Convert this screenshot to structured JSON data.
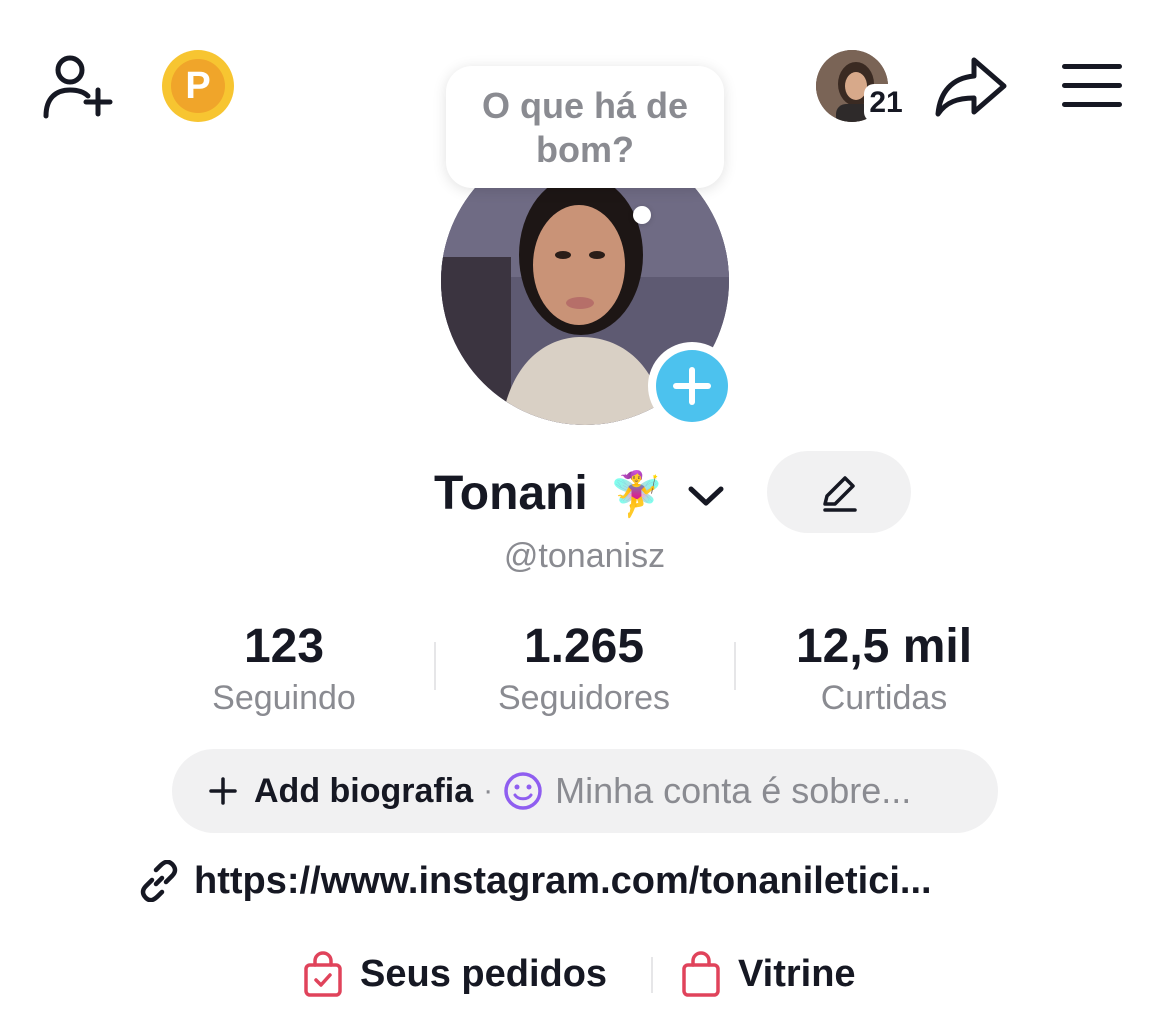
{
  "header": {
    "add_friend_icon": "person-plus-icon",
    "coin_letter": "P",
    "story_count": "21",
    "share_icon": "share-arrow-icon",
    "menu_icon": "hamburger-menu-icon"
  },
  "bubble": {
    "text": "O que há de bom?"
  },
  "profile": {
    "name": "Tonani",
    "emoji": "🧚‍♀️",
    "handle": "@tonanisz"
  },
  "stats": [
    {
      "value": "123",
      "label": "Seguindo"
    },
    {
      "value": "1.265",
      "label": "Seguidores"
    },
    {
      "value": "12,5 mil",
      "label": "Curtidas"
    }
  ],
  "bio": {
    "add_label": "Add biografia",
    "separator": "·",
    "placeholder": "Minha conta é sobre..."
  },
  "link": {
    "url": "https://www.instagram.com/tonaniletici..."
  },
  "shop": {
    "orders_label": "Seus pedidos",
    "showcase_label": "Vitrine"
  },
  "colors": {
    "accent_blue": "#4cc2ee",
    "coin_yellow": "#f7c531",
    "shop_red": "#e0435b",
    "bio_purple": "#8f5ef0",
    "muted_gray": "#8a8b91"
  }
}
